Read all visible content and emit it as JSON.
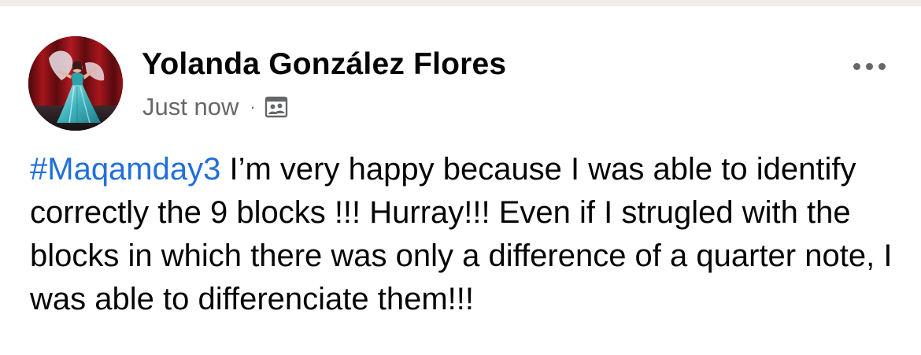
{
  "post": {
    "author": "Yolanda González Flores",
    "timestamp": "Just now",
    "separator": "·",
    "audience_icon": "photo-album-icon",
    "menu_icon": "more-options-icon",
    "hashtag": "#Maqamday3",
    "body_text": " I’m very happy because I was able to identify correctly the 9 blocks !!! Hurray!!! Even if I strugled with the blocks in which there was only a difference of a quarter note, I was able to differenciate them!!!"
  },
  "colors": {
    "hashtag": "#216fdb",
    "secondary_text": "#65676b",
    "primary_text": "#050505",
    "divider": "#f0ede9"
  }
}
